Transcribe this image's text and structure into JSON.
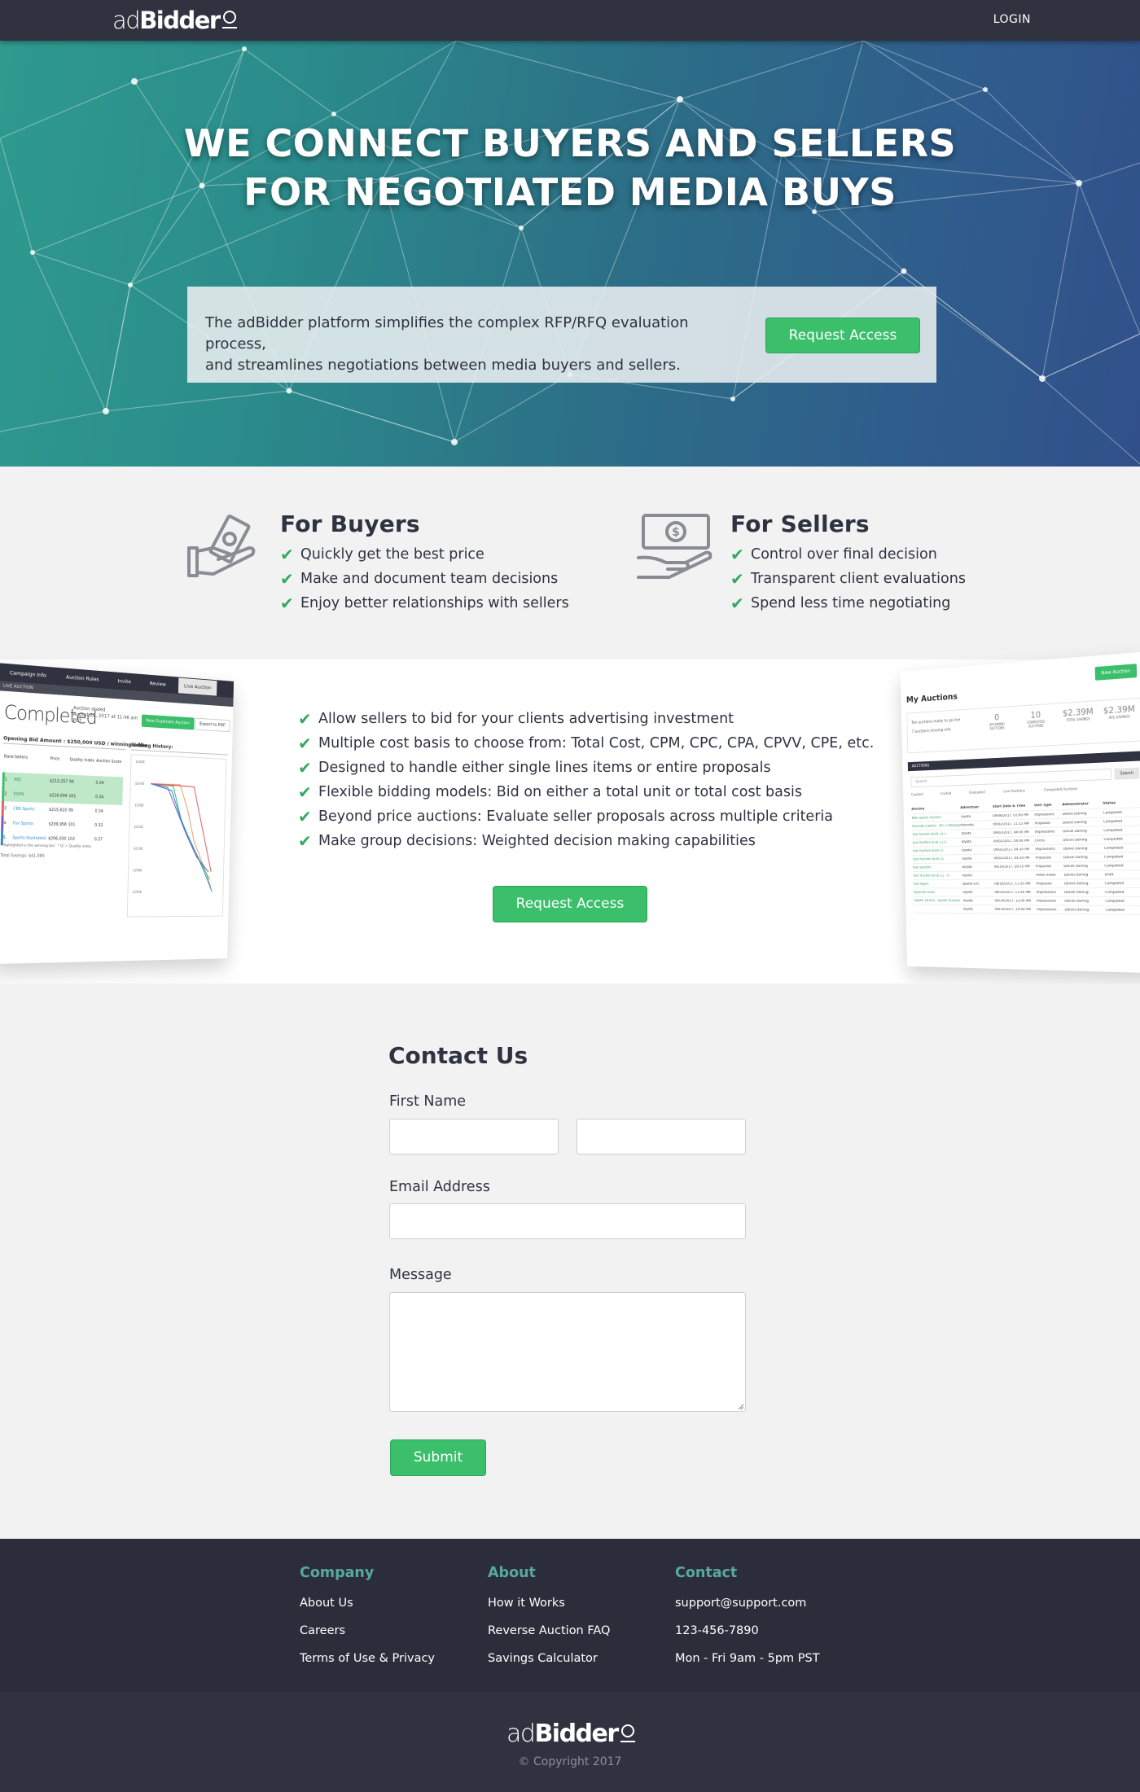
{
  "nav": {
    "brand_light": "ad",
    "brand_bold": "Bidder",
    "login": "LOGIN"
  },
  "hero": {
    "title_line1": "WE CONNECT BUYERS AND SELLERS",
    "title_line2": "FOR NEGOTIATED MEDIA BUYS",
    "text_line1": "The adBidder platform simplifies the complex RFP/RFQ evaluation process,",
    "text_line2": "and streamlines negotiations between media buyers and sellers.",
    "button": "Request Access"
  },
  "buyers": {
    "title": "For Buyers",
    "items": [
      "Quickly get the best price",
      "Make and document team decisions",
      "Enjoy better relationships with sellers"
    ]
  },
  "sellers": {
    "title": "For Sellers",
    "items": [
      "Control over final decision",
      "Transparent client evaluations",
      "Spend less time negotiating"
    ]
  },
  "showcase": {
    "items": [
      "Allow sellers to bid for your clients advertising investment",
      "Multiple cost basis to choose from: Total Cost, CPM, CPC, CPA, CPVV, CPE, etc.",
      "Designed to handle either single lines items or entire proposals",
      "Flexible bidding models: Bid on either a total unit or total cost basis",
      "Beyond price auctions: Evaluate seller proposals across multiple criteria",
      "Make group decisions: Weighted decision making capabilities"
    ],
    "button": "Request Access",
    "left_shot": {
      "tabs": [
        "Campaign Info",
        "Auction Rules",
        "Invite",
        "Review",
        "Live Auction"
      ],
      "subheader": "LIVE AUCTION",
      "status": "Completed",
      "ended_line1": "Auction ended",
      "ended_line2": "August 23, 2017 at 11:46 am",
      "ended_line3": "PDT",
      "duplicate_button": "New Duplicate Auction",
      "export_button": "Export to PDF",
      "opening_bid": "Opening Bid Amount : $250,000 USD / winning seller",
      "bidding_history": "Bidding History:",
      "table_headers": [
        "Rank",
        "Sellers",
        "Price",
        "Quality Index",
        "Auction Score"
      ],
      "rows": [
        {
          "rank": "1",
          "seller": "ABC",
          "price": "$213,257",
          "quality": "99",
          "score": "0.34"
        },
        {
          "rank": "2",
          "seller": "ESPN",
          "price": "$216,604",
          "quality": "101",
          "score": "0.34"
        },
        {
          "rank": "3",
          "seller": "CBS Sports",
          "price": "$215,610",
          "quality": "99",
          "score": "0.34"
        },
        {
          "rank": "4",
          "seller": "Fox Sports",
          "price": "$209,958",
          "quality": "101",
          "score": "0.32"
        },
        {
          "rank": "5",
          "seller": "Sports Illustrated",
          "price": "$206,030",
          "quality": "102",
          "score": "0.37"
        }
      ],
      "footnote": "*Highlighted is the winning bid · * QI = Quality index",
      "savings": "Total Savings: $41,089",
      "y_ticks": [
        "$260K",
        "$240K",
        "$230K",
        "$220K",
        "$210K",
        "$200K",
        "$190K"
      ]
    },
    "right_shot": {
      "title": "My Auctions",
      "new_button": "New Auction",
      "notice1": "Ten auctions ready to go live",
      "notice2": "7 auctions missing info",
      "stats": [
        {
          "value": "0",
          "label": "UPCOMING AUCTIONS"
        },
        {
          "value": "10",
          "label": "COMPLETED AUCTIONS"
        },
        {
          "value": "$2.39M",
          "label": "TOTAL SAVINGS"
        },
        {
          "value": "$2.39M",
          "label": "AVG SAVINGS"
        }
      ],
      "panel_header": "AUCTIONS",
      "search_placeholder": "Search",
      "search_button": "Search",
      "filters": [
        "Created",
        "Invited",
        "Evaluated",
        "Live Auctions",
        "Completed Auctions"
      ],
      "headers": [
        "Auction",
        "Advertiser",
        "Start Date & Time",
        "Unit Type",
        "Administrator",
        "Status"
      ],
      "rows": [
        [
          "NBA Sports Auction",
          "Toyota",
          "09/08/2017, 01:00 PM",
          "Impressions",
          "Daniel Darling",
          "Completed"
        ],
        [
          "Hyundai Elantra - NFL Campaign",
          "Hyundai",
          "09/02/2017, 11:15 AM",
          "Proposals",
          "Daniel Darling",
          "Completed"
        ],
        [
          "Test Auction 8/30 15:3",
          "Toyota",
          "09/02/2017, 04:00 PM",
          "Impressions",
          "Daniel Darling",
          "Completed"
        ],
        [
          "Test Auction 8/30 11:3",
          "Toyota",
          "09/02/2017, 04:40 PM",
          "Clicks",
          "Daniel Darling",
          "Completed"
        ],
        [
          "Test Auction 8/28 17",
          "Toyota",
          "09/02/2017, 04:30 PM",
          "Impressions",
          "Daniel Darling",
          "Completed"
        ],
        [
          "Test Auction 8/28 15",
          "Toyota",
          "09/02/2017, 04:20 PM",
          "Proposals",
          "Daniel Darling",
          "Completed"
        ],
        [
          "test auction",
          "Toyota",
          "08/19/2017, 09:10 PM",
          "Proposals",
          "Daniel Darling",
          "Completed"
        ],
        [
          "Test Auction 8/16 21 - A",
          "Toyota",
          "",
          "Video Views",
          "Daniel Darling",
          "Draft"
        ],
        [
          "Test Again",
          "Sparta Ent.",
          "08/18/2017, 11:20 AM",
          "Proposals",
          "Daniel Darling",
          "Completed"
        ],
        [
          "Hyundai Solos",
          "Toyota",
          "08/14/2017, 11:20 AM",
          "Impressions",
          "Daniel Darling",
          "Completed"
        ],
        [
          "Toyota Tundra - Sports Auction",
          "Toyota",
          "08/14/2017, 12:00 AM",
          "Impressions",
          "Daniel Darling",
          "Completed"
        ],
        [
          "",
          "Toyota",
          "08/10/2017, 10:00 PM",
          "Impressions",
          "Daniel Darling",
          "Completed"
        ]
      ]
    }
  },
  "contact": {
    "title": "Contact Us",
    "first_name_label": "First Name",
    "email_label": "Email Address",
    "message_label": "Message",
    "submit": "Submit"
  },
  "footer": {
    "company": {
      "title": "Company",
      "links": [
        "About Us",
        "Careers",
        "Terms of Use & Privacy"
      ]
    },
    "about": {
      "title": "About",
      "links": [
        "How it Works",
        "Reverse Auction FAQ",
        "Savings Calculator"
      ]
    },
    "contact": {
      "title": "Contact",
      "links": [
        "support@support.com",
        "123-456-7890",
        "Mon - Fri 9am - 5pm PST"
      ]
    },
    "copyright": "© Copyright 2017"
  },
  "colors": {
    "nav": "#30323f",
    "accent_green": "#3bbf6b",
    "footer_heading": "#59a8a0",
    "footer_bg": "#2b2d3a"
  }
}
